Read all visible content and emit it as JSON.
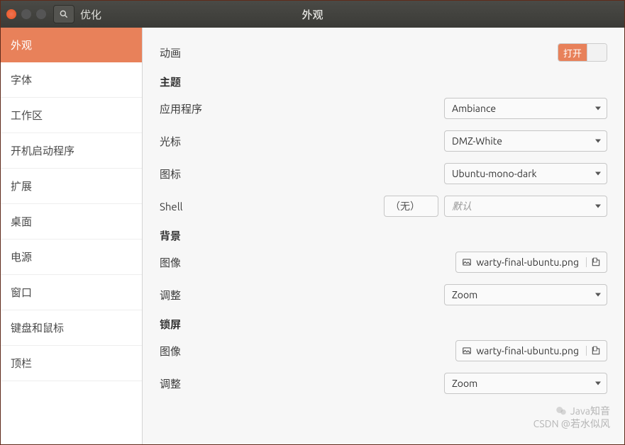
{
  "titlebar": {
    "app_name": "优化",
    "window_title": "外观"
  },
  "sidebar": {
    "items": [
      {
        "label": "外观",
        "active": true
      },
      {
        "label": "字体",
        "active": false
      },
      {
        "label": "工作区",
        "active": false
      },
      {
        "label": "开机启动程序",
        "active": false
      },
      {
        "label": "扩展",
        "active": false
      },
      {
        "label": "桌面",
        "active": false
      },
      {
        "label": "电源",
        "active": false
      },
      {
        "label": "窗口",
        "active": false
      },
      {
        "label": "键盘和鼠标",
        "active": false
      },
      {
        "label": "顶栏",
        "active": false
      }
    ]
  },
  "main": {
    "animation": {
      "label": "动画",
      "toggle_on_text": "打开"
    },
    "theme": {
      "title": "主题",
      "app": {
        "label": "应用程序",
        "value": "Ambiance"
      },
      "cursor": {
        "label": "光标",
        "value": "DMZ-White"
      },
      "icons": {
        "label": "图标",
        "value": "Ubuntu-mono-dark"
      },
      "shell": {
        "label": "Shell",
        "none_text": "（无）",
        "value": "默认"
      }
    },
    "background": {
      "title": "背景",
      "image": {
        "label": "图像",
        "value": "warty-final-ubuntu.png"
      },
      "adjust": {
        "label": "调整",
        "value": "Zoom"
      }
    },
    "lockscreen": {
      "title": "锁屏",
      "image": {
        "label": "图像",
        "value": "warty-final-ubuntu.png"
      },
      "adjust": {
        "label": "调整",
        "value": "Zoom"
      }
    }
  },
  "watermark": {
    "line1": "Java知音",
    "line2": "CSDN @若水似风"
  }
}
